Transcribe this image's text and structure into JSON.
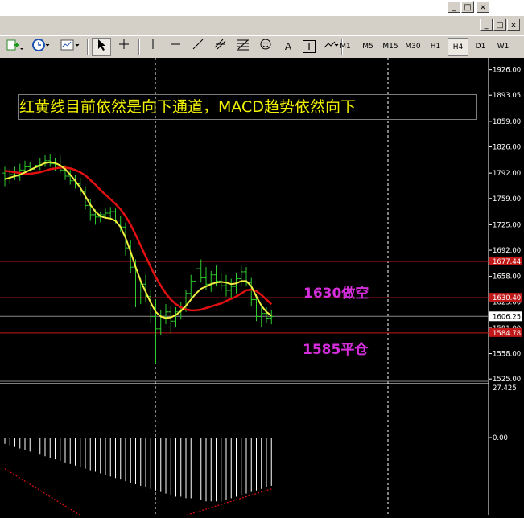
{
  "window": {
    "buttons": [
      "_",
      "□",
      "×"
    ],
    "inner_buttons": [
      "_",
      "□",
      "×"
    ]
  },
  "toolbar": {
    "timeframes": [
      "M1",
      "M5",
      "M15",
      "M30",
      "H1",
      "H4",
      "D1",
      "W1"
    ],
    "active_timeframe": "H4",
    "tool_glyphs": {
      "text_tool": "A",
      "label_tool": "T"
    }
  },
  "annotation": {
    "headline": "红黄线目前依然是向下通道，MACD趋势依然向下",
    "sell_label": "1630做空",
    "close_label": "1585平仓"
  },
  "price_axis": {
    "ticks": [
      "1926.00",
      "1893.05",
      "1859.00",
      "1826.00",
      "1792.00",
      "1759.00",
      "1725.00",
      "1692.00",
      "1658.00",
      "1625.00",
      "1591.00",
      "1558.00",
      "1525.00"
    ],
    "current_price": "1606.25",
    "marker_labels": [
      "1677.44",
      "1630.40",
      "1584.78"
    ]
  },
  "macd_axis": {
    "ticks": [
      "27.425",
      "0.00"
    ]
  },
  "colors": {
    "background": "#000000",
    "candle": "#2ecc2e",
    "red_ma": "#e01010",
    "yellow_ma": "#f0f040",
    "level_line": "#c01818",
    "headline_text": "#f2f200",
    "label_magenta": "#d42edb",
    "macd_hist": "#ffffff",
    "macd_signal": "#e01010"
  },
  "chart_data": {
    "type": "candlestick",
    "timeframe": "H4",
    "ylim": [
      1520,
      1935
    ],
    "levels": [
      1677.44,
      1630.4,
      1606.25,
      1584.78
    ],
    "candles": [
      {
        "o": 1792,
        "h": 1800,
        "l": 1775,
        "c": 1785
      },
      {
        "o": 1785,
        "h": 1797,
        "l": 1778,
        "c": 1790
      },
      {
        "o": 1790,
        "h": 1800,
        "l": 1783,
        "c": 1788
      },
      {
        "o": 1788,
        "h": 1804,
        "l": 1782,
        "c": 1796
      },
      {
        "o": 1796,
        "h": 1808,
        "l": 1790,
        "c": 1800
      },
      {
        "o": 1800,
        "h": 1806,
        "l": 1794,
        "c": 1797
      },
      {
        "o": 1797,
        "h": 1807,
        "l": 1792,
        "c": 1802
      },
      {
        "o": 1802,
        "h": 1812,
        "l": 1796,
        "c": 1806
      },
      {
        "o": 1806,
        "h": 1815,
        "l": 1800,
        "c": 1808
      },
      {
        "o": 1808,
        "h": 1816,
        "l": 1800,
        "c": 1804
      },
      {
        "o": 1804,
        "h": 1812,
        "l": 1795,
        "c": 1801
      },
      {
        "o": 1801,
        "h": 1815,
        "l": 1792,
        "c": 1796
      },
      {
        "o": 1796,
        "h": 1802,
        "l": 1783,
        "c": 1788
      },
      {
        "o": 1788,
        "h": 1796,
        "l": 1777,
        "c": 1782
      },
      {
        "o": 1782,
        "h": 1790,
        "l": 1772,
        "c": 1778
      },
      {
        "o": 1778,
        "h": 1786,
        "l": 1762,
        "c": 1768
      },
      {
        "o": 1768,
        "h": 1775,
        "l": 1745,
        "c": 1750
      },
      {
        "o": 1750,
        "h": 1758,
        "l": 1730,
        "c": 1738
      },
      {
        "o": 1738,
        "h": 1745,
        "l": 1725,
        "c": 1735
      },
      {
        "o": 1735,
        "h": 1742,
        "l": 1728,
        "c": 1738
      },
      {
        "o": 1738,
        "h": 1746,
        "l": 1733,
        "c": 1740
      },
      {
        "o": 1740,
        "h": 1748,
        "l": 1734,
        "c": 1742
      },
      {
        "o": 1742,
        "h": 1746,
        "l": 1727,
        "c": 1731
      },
      {
        "o": 1731,
        "h": 1736,
        "l": 1715,
        "c": 1722
      },
      {
        "o": 1722,
        "h": 1728,
        "l": 1685,
        "c": 1695
      },
      {
        "o": 1695,
        "h": 1705,
        "l": 1662,
        "c": 1670
      },
      {
        "o": 1670,
        "h": 1680,
        "l": 1618,
        "c": 1630
      },
      {
        "o": 1630,
        "h": 1655,
        "l": 1622,
        "c": 1648
      },
      {
        "o": 1648,
        "h": 1660,
        "l": 1624,
        "c": 1632
      },
      {
        "o": 1632,
        "h": 1640,
        "l": 1598,
        "c": 1606
      },
      {
        "o": 1606,
        "h": 1628,
        "l": 1544,
        "c": 1590
      },
      {
        "o": 1590,
        "h": 1615,
        "l": 1582,
        "c": 1608
      },
      {
        "o": 1608,
        "h": 1622,
        "l": 1596,
        "c": 1612
      },
      {
        "o": 1612,
        "h": 1620,
        "l": 1584,
        "c": 1600
      },
      {
        "o": 1600,
        "h": 1618,
        "l": 1592,
        "c": 1612
      },
      {
        "o": 1612,
        "h": 1625,
        "l": 1602,
        "c": 1618
      },
      {
        "o": 1618,
        "h": 1640,
        "l": 1612,
        "c": 1636
      },
      {
        "o": 1636,
        "h": 1660,
        "l": 1630,
        "c": 1652
      },
      {
        "o": 1652,
        "h": 1676,
        "l": 1644,
        "c": 1668
      },
      {
        "o": 1668,
        "h": 1680,
        "l": 1650,
        "c": 1656
      },
      {
        "o": 1656,
        "h": 1670,
        "l": 1640,
        "c": 1648
      },
      {
        "o": 1648,
        "h": 1665,
        "l": 1638,
        "c": 1660
      },
      {
        "o": 1660,
        "h": 1672,
        "l": 1645,
        "c": 1652
      },
      {
        "o": 1652,
        "h": 1662,
        "l": 1640,
        "c": 1646
      },
      {
        "o": 1646,
        "h": 1660,
        "l": 1632,
        "c": 1640
      },
      {
        "o": 1640,
        "h": 1655,
        "l": 1628,
        "c": 1645
      },
      {
        "o": 1645,
        "h": 1662,
        "l": 1636,
        "c": 1655
      },
      {
        "o": 1655,
        "h": 1672,
        "l": 1645,
        "c": 1664
      },
      {
        "o": 1664,
        "h": 1670,
        "l": 1645,
        "c": 1650
      },
      {
        "o": 1650,
        "h": 1656,
        "l": 1620,
        "c": 1628
      },
      {
        "o": 1628,
        "h": 1635,
        "l": 1600,
        "c": 1606
      },
      {
        "o": 1606,
        "h": 1620,
        "l": 1592,
        "c": 1610
      },
      {
        "o": 1610,
        "h": 1618,
        "l": 1598,
        "c": 1604
      },
      {
        "o": 1604,
        "h": 1614,
        "l": 1596,
        "c": 1606
      }
    ],
    "red_ma": [
      1795,
      1794,
      1793,
      1792,
      1791,
      1791,
      1792,
      1793,
      1795,
      1797,
      1798,
      1799,
      1799,
      1798,
      1796,
      1793,
      1789,
      1783,
      1777,
      1770,
      1764,
      1758,
      1752,
      1745,
      1736,
      1725,
      1712,
      1698,
      1684,
      1670,
      1657,
      1646,
      1636,
      1628,
      1622,
      1618,
      1615,
      1614,
      1614,
      1615,
      1617,
      1619,
      1621,
      1623,
      1626,
      1629,
      1632,
      1636,
      1640,
      1641,
      1639,
      1634,
      1628,
      1622
    ],
    "yellow_ma": [
      1784,
      1786,
      1788,
      1790,
      1793,
      1796,
      1799,
      1802,
      1805,
      1806,
      1805,
      1802,
      1797,
      1790,
      1782,
      1773,
      1762,
      1751,
      1742,
      1736,
      1734,
      1733,
      1730,
      1722,
      1708,
      1690,
      1670,
      1652,
      1638,
      1624,
      1612,
      1606,
      1604,
      1605,
      1608,
      1613,
      1620,
      1628,
      1636,
      1642,
      1645,
      1648,
      1650,
      1651,
      1650,
      1648,
      1649,
      1652,
      1652,
      1645,
      1632,
      1620,
      1612,
      1607
    ],
    "macd_hist": [
      -4,
      -5,
      -6,
      -7,
      -8,
      -9,
      -10,
      -11,
      -12,
      -13,
      -14,
      -15,
      -16,
      -17,
      -18,
      -19,
      -20,
      -21,
      -22,
      -23,
      -24,
      -25,
      -26,
      -27,
      -28,
      -29,
      -30,
      -31,
      -32,
      -33,
      -34,
      -35,
      -36,
      -37,
      -38,
      -38,
      -39,
      -39,
      -40,
      -40,
      -41,
      -41,
      -41,
      -41,
      -40,
      -39,
      -38,
      -37,
      -36,
      -35,
      -34,
      -33,
      -32,
      -31
    ],
    "macd_signal": [
      -20,
      -22,
      -24,
      -26,
      -28,
      -30,
      -32,
      -34,
      -36,
      -38,
      -40,
      -42,
      -44,
      -46,
      -48,
      -50,
      -51,
      -52,
      -53,
      -54,
      -55,
      -56,
      -57,
      -58,
      -58,
      -59,
      -59,
      -59,
      -58,
      -57,
      -56,
      -55,
      -54,
      -53,
      -52,
      -51,
      -50,
      -49,
      -48,
      -47,
      -46,
      -45,
      -44,
      -43,
      -42,
      -41,
      -40,
      -39,
      -38,
      -37,
      -36,
      -35,
      -34,
      -33
    ],
    "macd_ylim": [
      -60,
      27.425
    ]
  }
}
